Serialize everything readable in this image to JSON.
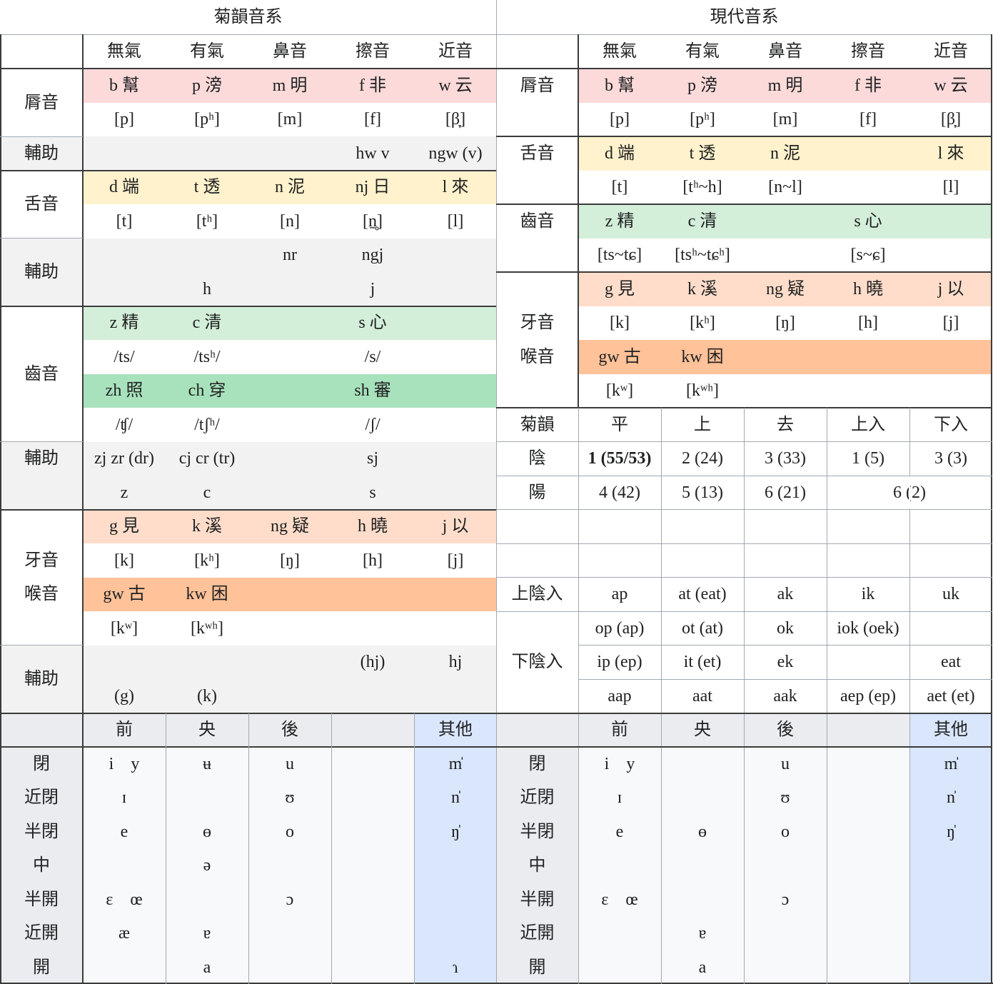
{
  "tables": {
    "left_title": "菊韻音系",
    "right_title": "現代音系",
    "left": {
      "manner_headers": [
        "無氣",
        "有氣",
        "鼻音",
        "擦音",
        "近音"
      ],
      "labials": {
        "label": "脣音",
        "letters": [
          "b 幫",
          "p 滂",
          "m 明",
          "f 非",
          "w 云"
        ],
        "ipa": [
          "[p]",
          "[pʰ]",
          "[m]",
          "[f]",
          "[β̞]"
        ]
      },
      "labial_aux": {
        "label": "輔助",
        "fricative": "hw v",
        "approximant": "ngw (v)"
      },
      "coronals": {
        "label": "舌音",
        "letters": [
          "d 端",
          "t 透",
          "n 泥",
          "nj 日",
          "l 來"
        ],
        "ipa": [
          "[t]",
          "[tʰ]",
          "[n]",
          "[n̠̥]",
          "[l]"
        ]
      },
      "coronal_aux": {
        "label": "輔助",
        "row1": {
          "nasal": "nr",
          "fricative": "ngj"
        },
        "row2": {
          "aspirated": "h",
          "fricative": "j"
        }
      },
      "sibilants": {
        "label": "齒音",
        "letters": [
          "z 精",
          "c 清",
          "s 心"
        ],
        "phonemes": [
          "/ts/",
          "/tsʰ/",
          "/s/"
        ],
        "retro_letters": [
          "zh 照",
          "ch 穿",
          "sh 審"
        ],
        "retro_phonemes": [
          "/ʧ/",
          "/tʃʰ/",
          "/ʃ/"
        ]
      },
      "sibilant_aux": {
        "label": "輔助",
        "row1": [
          "zj zr (dr)",
          "cj cr (tr)",
          "sj"
        ],
        "row2": [
          "z",
          "c",
          "s"
        ]
      },
      "velars": {
        "label_1": "牙音",
        "label_2": "喉音",
        "letters": [
          "g 見",
          "k 溪",
          "ng 疑",
          "h 曉",
          "j 以"
        ],
        "ipa": [
          "[k]",
          "[kʰ]",
          "[ŋ]",
          "[h]",
          "[j]"
        ],
        "labio_letters": [
          "gw 古",
          "kw 困"
        ],
        "labio_ipa": [
          "[kʷ]",
          "[kʷʰ]"
        ]
      },
      "velar_aux": {
        "label": "輔助",
        "row1": {
          "fricative": "(hj)",
          "approximant": "hj"
        },
        "row2": {
          "unaspirated": "(g)",
          "aspirated": "(k)"
        }
      }
    },
    "right": {
      "manner_headers": [
        "無氣",
        "有氣",
        "鼻音",
        "擦音",
        "近音"
      ],
      "labials": {
        "label": "脣音",
        "letters": [
          "b 幫",
          "p 滂",
          "m 明",
          "f 非",
          "w 云"
        ],
        "ipa": [
          "[p]",
          "[pʰ]",
          "[m]",
          "[f]",
          "[β̞]"
        ]
      },
      "coronals": {
        "label": "舌音",
        "letters": [
          "d 端",
          "t 透",
          "n 泥",
          "l 來"
        ],
        "ipa": [
          "[t]",
          "[tʰ~h]",
          "[n~l]",
          "[l]"
        ]
      },
      "sibilants": {
        "label": "齒音",
        "letters": [
          "z 精",
          "c 清",
          "s 心"
        ],
        "ipa": [
          "[ts~tɕ]",
          "[tsʰ~tɕʰ]",
          "[s~ɕ]"
        ]
      },
      "velars": {
        "label_1": "牙音",
        "label_2": "喉音",
        "letters": [
          "g 見",
          "k 溪",
          "ng 疑",
          "h 曉",
          "j 以"
        ],
        "ipa": [
          "[k]",
          "[kʰ]",
          "[ŋ]",
          "[h]",
          "[j]"
        ],
        "labio_letters": [
          "gw 古",
          "kw 困"
        ],
        "labio_ipa": [
          "[kʷ]",
          "[kʷʰ]"
        ]
      }
    },
    "tones": {
      "headers": [
        "菊韻",
        "平",
        "上",
        "去",
        "上入",
        "下入"
      ],
      "yin": {
        "label": "陰",
        "values": [
          "1 (55/53)",
          "2 (24)",
          "3 (33)",
          "1 (5)",
          "3 (3)"
        ]
      },
      "yang": {
        "label": "陽",
        "values": [
          "4 (42)",
          "5 (13)",
          "6 (21)",
          "6 (2)"
        ]
      }
    },
    "checked": {
      "upper_label": "上陰入",
      "lower_label": "下陰入",
      "upper": [
        "ap",
        "at (eat)",
        "ak",
        "ik",
        "uk"
      ],
      "lower1": [
        "op (ap)",
        "ot (at)",
        "ok",
        "iok (oek)",
        ""
      ],
      "lower2": [
        "ip (ep)",
        "it (et)",
        "ek",
        "",
        "eat"
      ],
      "lower3": [
        "aap",
        "aat",
        "aak",
        "aep (ep)",
        "aet (et)"
      ]
    },
    "vowels": {
      "headers": [
        "前",
        "央",
        "後",
        "",
        "其他"
      ],
      "heights": [
        "閉",
        "近閉",
        "半閉",
        "中",
        "半開",
        "近開",
        "開"
      ],
      "left": {
        "front": [
          "i y",
          "ɪ",
          "e",
          "",
          "ɛ œ",
          "æ",
          ""
        ],
        "central": [
          "ʉ",
          "",
          "ɵ",
          "ə",
          "",
          "ɐ",
          "a"
        ],
        "back": [
          "u",
          "ʊ",
          "o",
          "",
          "ɔ",
          "",
          ""
        ],
        "other": [
          "m̍",
          "n̍",
          "ŋ̍",
          "",
          "",
          "",
          "ɿ"
        ]
      },
      "right": {
        "front": [
          "i y",
          "ɪ",
          "e",
          "",
          "ɛ œ",
          "",
          ""
        ],
        "central": [
          "",
          "",
          "ɵ",
          "",
          "",
          "ɐ",
          "a"
        ],
        "back": [
          "u",
          "ʊ",
          "o",
          "",
          "ɔ",
          "",
          ""
        ],
        "other": [
          "m̍",
          "n̍",
          "ŋ̍",
          "",
          "",
          "",
          ""
        ]
      }
    }
  }
}
